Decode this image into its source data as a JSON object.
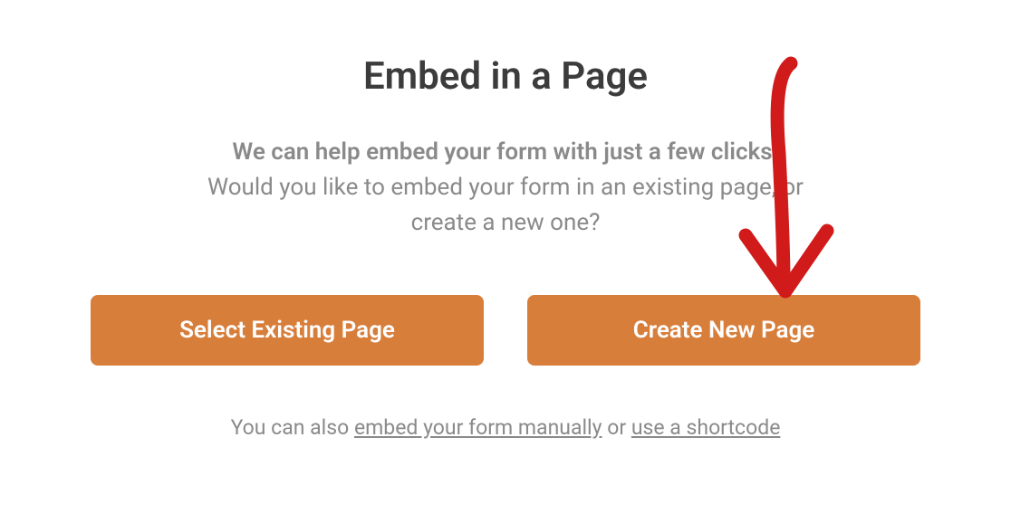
{
  "dialog": {
    "title": "Embed in a Page",
    "subtitle_bold": "We can help embed your form with just a few clicks!",
    "subtitle_line1": "Would you like to embed your form in an existing page, or",
    "subtitle_line2": "create a new one?",
    "buttons": {
      "select_existing": "Select Existing Page",
      "create_new": "Create New Page"
    },
    "footer": {
      "prefix": "You can also ",
      "link_manual": "embed your form manually",
      "mid": " or ",
      "link_shortcode": "use a shortcode"
    }
  }
}
